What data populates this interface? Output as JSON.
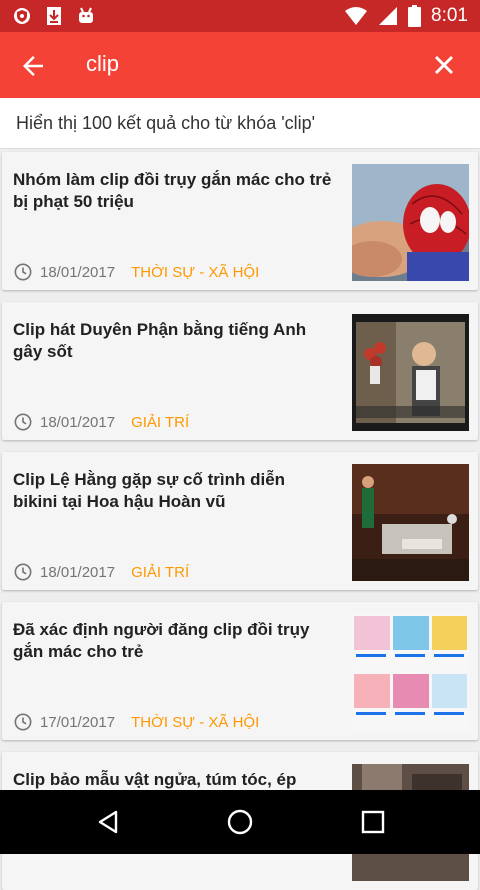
{
  "status_bar": {
    "time": "8:01",
    "icons_left": [
      "shield-icon",
      "download-icon",
      "android-icon"
    ],
    "icons_right": [
      "wifi-icon",
      "signal-icon",
      "battery-icon"
    ]
  },
  "app_bar": {
    "search_query": "clip",
    "back_icon": "arrow-back-icon",
    "clear_icon": "close-icon"
  },
  "results_banner": "Hiển thị 100 kết quả cho từ khóa 'clip'",
  "articles": [
    {
      "title": "Nhóm làm clip đồi trụy gắn mác cho trẻ bị phạt 50 triệu",
      "date": "18/01/2017",
      "category": "THỜI SỰ - XÃ HỘI"
    },
    {
      "title": "Clip hát Duyên Phận bằng tiếng Anh gây sốt",
      "date": "18/01/2017",
      "category": "GIẢI TRÍ"
    },
    {
      "title": "Clip Lệ Hằng gặp sự cố trình diễn bikini tại Hoa hậu Hoàn vũ",
      "date": "18/01/2017",
      "category": "GIẢI TRÍ"
    },
    {
      "title": "Đã xác định người đăng clip đồi trụy gắn mác cho trẻ",
      "date": "17/01/2017",
      "category": "THỜI SỰ - XÃ HỘI"
    },
    {
      "title": "Clip bảo mẫu vật ngửa, túm tóc, ép",
      "date": "",
      "category": ""
    }
  ],
  "colors": {
    "status_bar": "#c62828",
    "app_bar": "#f44336",
    "category": "#ff9800"
  },
  "nav_bar": {
    "icons": [
      "nav-back-icon",
      "nav-home-icon",
      "nav-recents-icon"
    ]
  }
}
